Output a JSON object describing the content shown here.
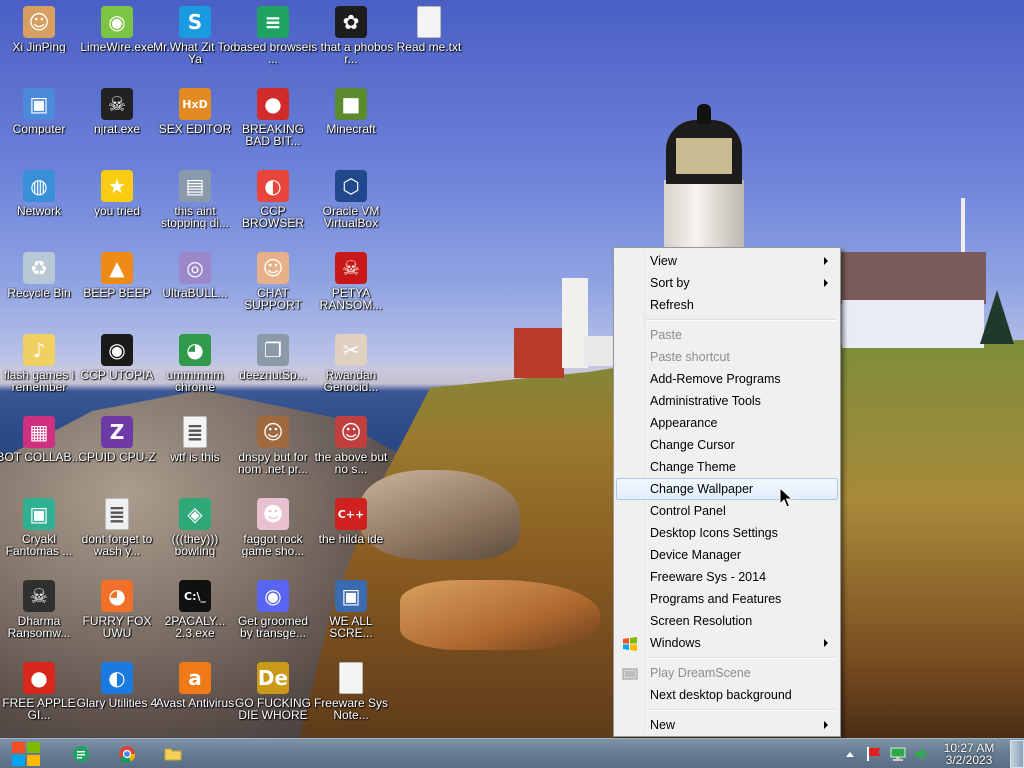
{
  "desktop_icons": [
    {
      "label": "Xi JinPing",
      "icon": "xi-portrait-icon",
      "color": "#d8a060",
      "glyph": "☺"
    },
    {
      "label": "LimeWire.exe",
      "icon": "limewire-icon",
      "color": "#7cc443",
      "glyph": "◉"
    },
    {
      "label": "Mr.What Zit Too Ya",
      "icon": "skype-icon",
      "color": "#1a9ae0",
      "glyph": "S"
    },
    {
      "label": "based browser ...",
      "icon": "doc-green-icon",
      "color": "#1ea362",
      "glyph": "≡"
    },
    {
      "label": "is that a phobos r...",
      "icon": "tree-app-icon",
      "color": "#1d1d1d",
      "glyph": "✿"
    },
    {
      "label": "Read me.txt",
      "icon": "text-file-icon",
      "color": "#f4f4f4",
      "glyph": ""
    },
    {
      "label": "Computer",
      "icon": "computer-icon",
      "color": "#4a8ad8",
      "glyph": "▣"
    },
    {
      "label": "njrat.exe",
      "icon": "skull-icon",
      "color": "#222222",
      "glyph": "☠"
    },
    {
      "label": "SEX EDITOR",
      "icon": "hex-editor-icon",
      "color": "#e08a20",
      "glyph": "HxD"
    },
    {
      "label": "BREAKING BAD BIT...",
      "icon": "angry-bird-icon",
      "color": "#d12c2c",
      "glyph": "●"
    },
    {
      "label": "Minecraft",
      "icon": "minecraft-icon",
      "color": "#5c8a2e",
      "glyph": "■"
    },
    {
      "label": "Network",
      "icon": "network-icon",
      "color": "#3a8fd9",
      "glyph": "◍"
    },
    {
      "label": "you tried",
      "icon": "star-icon",
      "color": "#f7cc13",
      "glyph": "★"
    },
    {
      "label": "this aint stopping di...",
      "icon": "installer-icon",
      "color": "#8a9aaa",
      "glyph": "▤"
    },
    {
      "label": "CCP BROWSER",
      "icon": "chromium-icon",
      "color": "#e9453a",
      "glyph": "◐"
    },
    {
      "label": "Oracle VM VirtualBox",
      "icon": "virtualbox-icon",
      "color": "#21488c",
      "glyph": "⬡"
    },
    {
      "label": "Recycle Bin",
      "icon": "recycle-bin-icon",
      "color": "#b9c8d6",
      "glyph": "♻"
    },
    {
      "label": "BEEP BEEP",
      "icon": "vlc-cone-icon",
      "color": "#f08a16",
      "glyph": "▲"
    },
    {
      "label": "UltraBULL...",
      "icon": "disc-icon",
      "color": "#9a88c8",
      "glyph": "◎"
    },
    {
      "label": "CHAT SUPPORT",
      "icon": "support-agent-icon",
      "color": "#e8b088",
      "glyph": "☺"
    },
    {
      "label": "PETYA RANSOM...",
      "icon": "petya-icon",
      "color": "#c81818",
      "glyph": "☠"
    },
    {
      "label": "flash games i remember",
      "icon": "folder-music-icon",
      "color": "#f0d060",
      "glyph": "♪"
    },
    {
      "label": "CCP UTOPIA",
      "icon": "ccp-utopia-icon",
      "color": "#1a1a1a",
      "glyph": "◉"
    },
    {
      "label": "ummmmm chrome",
      "icon": "chrome-icon",
      "color": "#2f9a4a",
      "glyph": "◕"
    },
    {
      "label": "deeznutSp...",
      "icon": "windows-copy-icon",
      "color": "#8a9aa8",
      "glyph": "❐"
    },
    {
      "label": "Rwandan Genocid...",
      "icon": "rwandan-icon",
      "color": "#e0d0c0",
      "glyph": "✂"
    },
    {
      "label": "BOT COLLAB...",
      "icon": "bot-collab-icon",
      "color": "#d03080",
      "glyph": "▦"
    },
    {
      "label": "CPUID CPU-Z",
      "icon": "cpuz-icon",
      "color": "#6e3aa8",
      "glyph": "Z"
    },
    {
      "label": "wtf is this",
      "icon": "text-doc-icon",
      "color": "#f4f4f4",
      "glyph": "≣"
    },
    {
      "label": "dnspy but for nom .net pr...",
      "icon": "portrait-woman-icon",
      "color": "#a06a40",
      "glyph": "☺"
    },
    {
      "label": "the above but no s...",
      "icon": "portrait-woman-red-icon",
      "color": "#c04040",
      "glyph": "☺"
    },
    {
      "label": "Cryakl Fantomas ...",
      "icon": "cryakl-icon",
      "color": "#30b090",
      "glyph": "▣"
    },
    {
      "label": "dont forget to wash y...",
      "icon": "notepad-icon",
      "color": "#f0f0f0",
      "glyph": "≣"
    },
    {
      "label": "(((they))) bowling",
      "icon": "bowling-icon",
      "color": "#2fa878",
      "glyph": "◈"
    },
    {
      "label": "faggot rock game sho...",
      "icon": "cartoon-face-icon",
      "color": "#e8c0d0",
      "glyph": "☻"
    },
    {
      "label": "the hilda ide",
      "icon": "devcpp-icon",
      "color": "#d02020",
      "glyph": "C++"
    },
    {
      "label": "Dharma Ransomw...",
      "icon": "dharma-skull-icon",
      "color": "#303030",
      "glyph": "☠"
    },
    {
      "label": "FURRY FOX UWU",
      "icon": "firefox-icon",
      "color": "#f2702a",
      "glyph": "◕"
    },
    {
      "label": "2PACALY... 2.3.exe",
      "icon": "cmd-icon",
      "color": "#111111",
      "glyph": "C:\\_"
    },
    {
      "label": "Get groomed by transge...",
      "icon": "discord-icon",
      "color": "#5865f2",
      "glyph": "◉"
    },
    {
      "label": "WE ALL SCRE...",
      "icon": "pc-screen-icon",
      "color": "#3a6ab0",
      "glyph": "▣"
    },
    {
      "label": "FREE APPLE GI...",
      "icon": "apple-icon",
      "color": "#d8281e",
      "glyph": "●"
    },
    {
      "label": "Glary Utilities 4",
      "icon": "glary-icon",
      "color": "#1a7ae0",
      "glyph": "◐"
    },
    {
      "label": "Avast Antivirus",
      "icon": "avast-icon",
      "color": "#f07a18",
      "glyph": "a"
    },
    {
      "label": "GO FUCKING DIE WHORE",
      "icon": "de-app-icon",
      "color": "#c89a18",
      "glyph": "De"
    },
    {
      "label": "Freeware Sys Note...",
      "icon": "blank-file-icon",
      "color": "#f4f4f4",
      "glyph": ""
    }
  ],
  "context_menu": {
    "items": [
      {
        "label": "View",
        "submenu": true,
        "disabled": false
      },
      {
        "label": "Sort by",
        "submenu": true,
        "disabled": false
      },
      {
        "label": "Refresh",
        "submenu": false,
        "disabled": false
      },
      {
        "separator": true
      },
      {
        "label": "Paste",
        "submenu": false,
        "disabled": true
      },
      {
        "label": "Paste shortcut",
        "submenu": false,
        "disabled": true
      },
      {
        "label": "Add-Remove Programs",
        "submenu": false,
        "disabled": false
      },
      {
        "label": "Administrative Tools",
        "submenu": false,
        "disabled": false
      },
      {
        "label": "Appearance",
        "submenu": false,
        "disabled": false
      },
      {
        "label": "Change Cursor",
        "submenu": false,
        "disabled": false
      },
      {
        "label": "Change Theme",
        "submenu": false,
        "disabled": false
      },
      {
        "label": "Change Wallpaper",
        "submenu": false,
        "disabled": false,
        "hovered": true
      },
      {
        "label": "Control Panel",
        "submenu": false,
        "disabled": false
      },
      {
        "label": "Desktop Icons Settings",
        "submenu": false,
        "disabled": false
      },
      {
        "label": "Device Manager",
        "submenu": false,
        "disabled": false
      },
      {
        "label": "Freeware Sys - 2014",
        "submenu": false,
        "disabled": false
      },
      {
        "label": "Programs and Features",
        "submenu": false,
        "disabled": false
      },
      {
        "label": "Screen Resolution",
        "submenu": false,
        "disabled": false
      },
      {
        "label": "Windows",
        "submenu": true,
        "disabled": false,
        "lead_icon": "windows-flag-icon"
      },
      {
        "separator": true
      },
      {
        "label": "Play DreamScene",
        "submenu": false,
        "disabled": true,
        "lead_icon": "dreamscene-icon"
      },
      {
        "label": "Next desktop background",
        "submenu": false,
        "disabled": false
      },
      {
        "separator": true
      },
      {
        "label": "New",
        "submenu": true,
        "disabled": false
      }
    ]
  },
  "taskbar": {
    "start_icon": "windows-start-icon",
    "pinned": [
      {
        "name": "notes-app-icon",
        "color": "#1ea362"
      },
      {
        "name": "chrome-icon",
        "color": "#e9453a"
      },
      {
        "name": "explorer-folder-icon",
        "color": "#f0c040"
      }
    ],
    "tray_icons": [
      "show-hidden-icons-icon",
      "action-center-flag-icon",
      "network-tray-icon",
      "volume-icon"
    ],
    "clock_time": "10:27 AM",
    "clock_date": "3/2/2023"
  },
  "colors": {
    "menu_bg": "#f0f0f0",
    "menu_hover": "#e3eefc",
    "taskbar": "#667c92"
  }
}
